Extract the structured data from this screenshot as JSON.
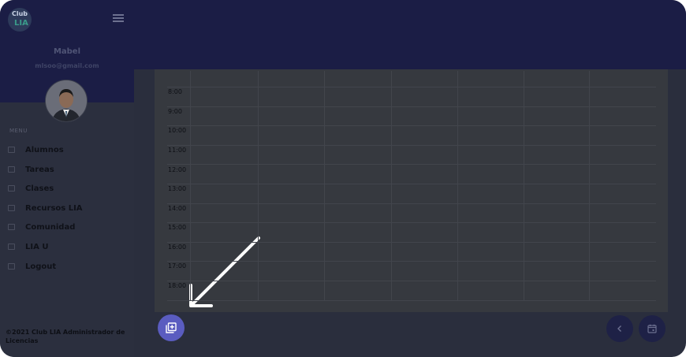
{
  "brand": {
    "logo_line1": "Club",
    "logo_line2": "LIA"
  },
  "user": {
    "name": "Mabel",
    "email": "mlsoo@gmail.com"
  },
  "sidebar": {
    "menu_title": "MENU",
    "items": [
      {
        "label": "Alumnos",
        "icon": "users-icon"
      },
      {
        "label": "Tareas",
        "icon": "clipboard-icon"
      },
      {
        "label": "Clases",
        "icon": "classes-icon"
      },
      {
        "label": "Recursos LIA",
        "icon": "resources-icon"
      },
      {
        "label": "Comunidad",
        "icon": "chat-icon"
      },
      {
        "label": "LIA U",
        "icon": "school-icon"
      },
      {
        "label": "Logout",
        "icon": "logout-icon"
      }
    ],
    "footer": "©2021 Club LIA Administrador de Licencias"
  },
  "calendar": {
    "hours": [
      "8:00",
      "9:00",
      "10:00",
      "11:00",
      "12:00",
      "13:00",
      "14:00",
      "15:00",
      "16:00",
      "17:00",
      "18:00"
    ]
  },
  "actions": {
    "add_icon": "add-library-icon",
    "back_icon": "chevron-left-icon",
    "calendar_icon": "calendar-icon"
  },
  "colors": {
    "header_bg": "#1b1d45",
    "fab_bg": "#5a5cc0",
    "nav_bg": "#1e2146"
  }
}
